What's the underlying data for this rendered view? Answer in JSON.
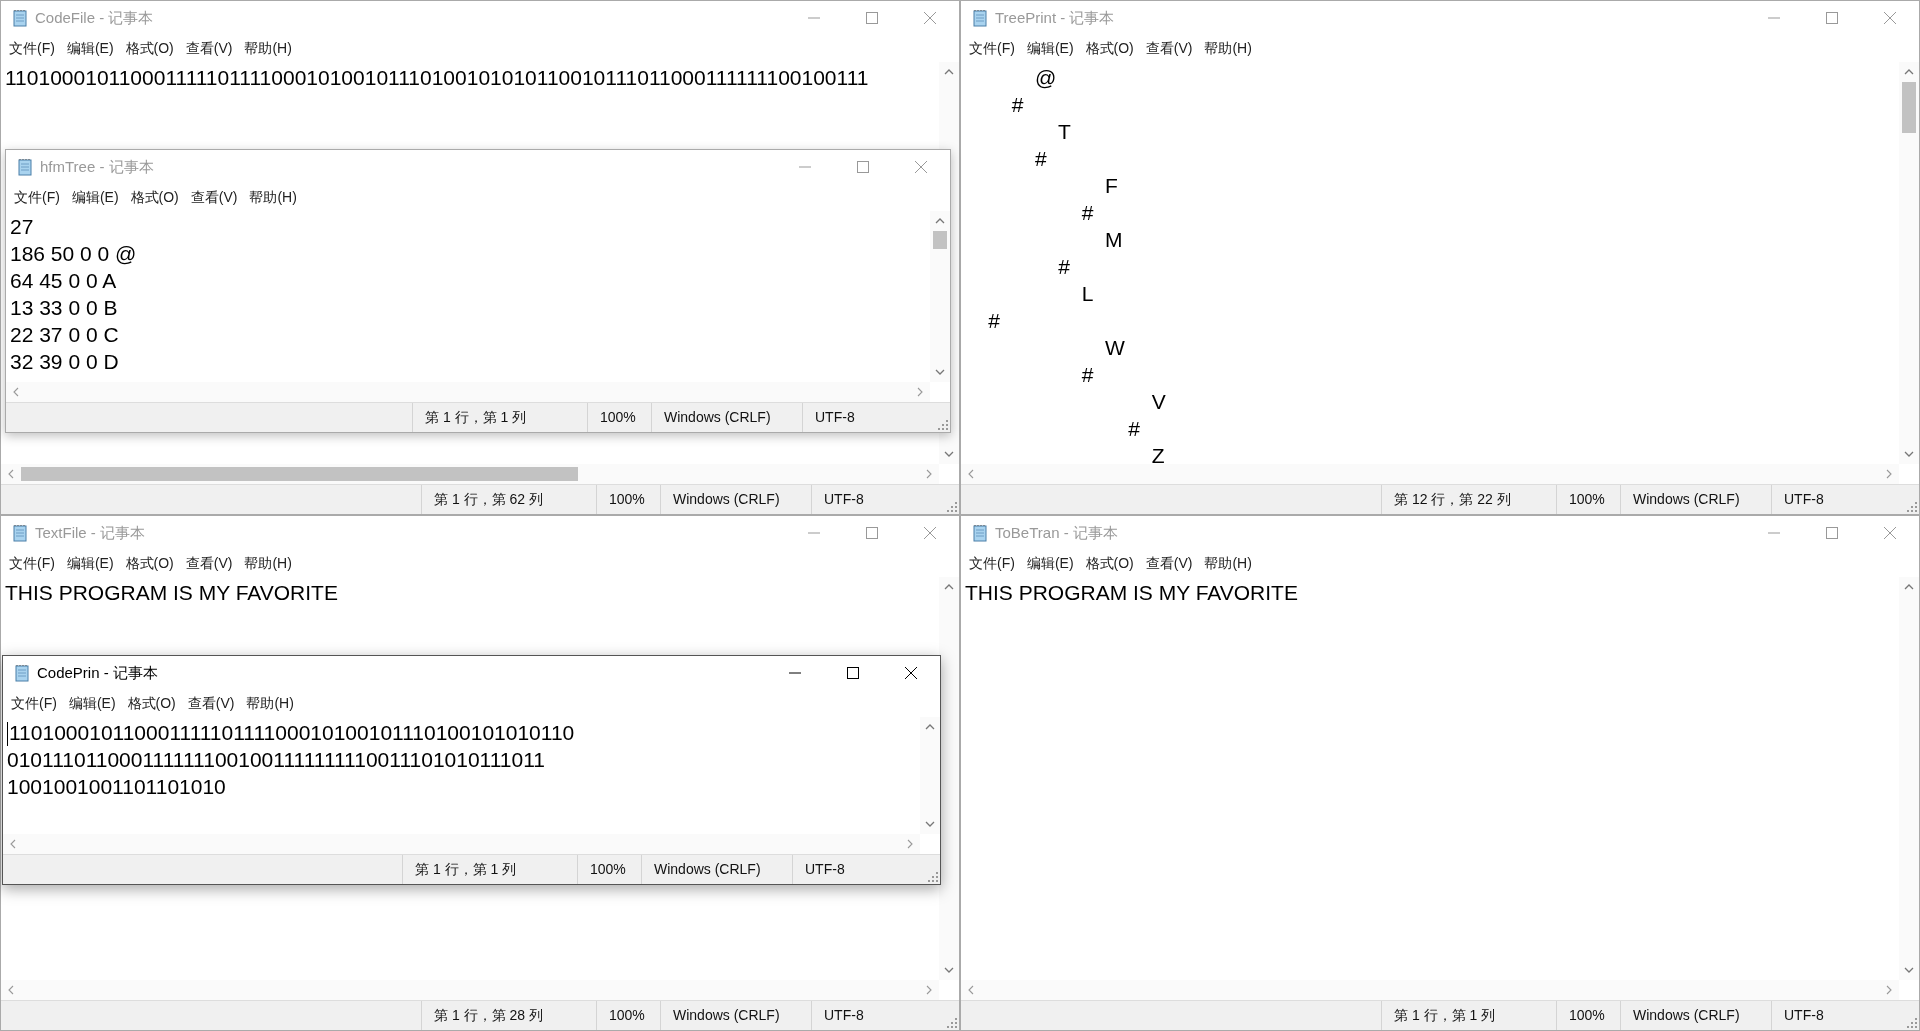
{
  "windows": [
    {
      "title": "CodeFile - 记事本",
      "active": false,
      "caret": false,
      "v_thumb": false,
      "h_thumb": true,
      "menu": [
        "文件(F)",
        "编辑(E)",
        "格式(O)",
        "查看(V)",
        "帮助(H)"
      ],
      "lines": [
        "11010001011000111110111100010100101110100101010110010111011000111111100100111"
      ],
      "status": {
        "position": "第 1 行，第 62 列",
        "zoom": "100%",
        "line_ending": "Windows (CRLF)",
        "encoding": "UTF-8"
      }
    },
    {
      "title": "hfmTree - 记事本",
      "active": false,
      "caret": false,
      "v_thumb": true,
      "h_thumb": false,
      "menu": [
        "文件(F)",
        "编辑(E)",
        "格式(O)",
        "查看(V)",
        "帮助(H)"
      ],
      "lines": [
        "27",
        "186 50 0 0 @",
        "64 45 0 0 A",
        "13 33 0 0 B",
        "22 37 0 0 C",
        "32 39 0 0 D"
      ],
      "status": {
        "position": "第 1 行，第 1 列",
        "zoom": "100%",
        "line_ending": "Windows (CRLF)",
        "encoding": "UTF-8"
      }
    },
    {
      "title": "TreePrint - 记事本",
      "active": false,
      "caret": false,
      "v_thumb": true,
      "h_thumb": false,
      "menu": [
        "文件(F)",
        "编辑(E)",
        "格式(O)",
        "查看(V)",
        "帮助(H)"
      ],
      "lines": [
        "            @",
        "        #",
        "                T",
        "            #",
        "                        F",
        "                    #",
        "                        M",
        "                #",
        "                    L",
        "    #",
        "                        W",
        "                    #",
        "                                V",
        "                            #",
        "                                Z"
      ],
      "status": {
        "position": "第 12 行，第 22 列",
        "zoom": "100%",
        "line_ending": "Windows (CRLF)",
        "encoding": "UTF-8"
      }
    },
    {
      "title": "TextFile - 记事本",
      "active": false,
      "caret": false,
      "v_thumb": false,
      "h_thumb": false,
      "menu": [
        "文件(F)",
        "编辑(E)",
        "格式(O)",
        "查看(V)",
        "帮助(H)"
      ],
      "lines": [
        "THIS PROGRAM IS MY FAVORITE"
      ],
      "status": {
        "position": "第 1 行，第 28 列",
        "zoom": "100%",
        "line_ending": "Windows (CRLF)",
        "encoding": "UTF-8"
      }
    },
    {
      "title": "CodePrin - 记事本",
      "active": true,
      "caret": true,
      "v_thumb": false,
      "h_thumb": false,
      "menu": [
        "文件(F)",
        "编辑(E)",
        "格式(O)",
        "查看(V)",
        "帮助(H)"
      ],
      "lines": [
        "11010001011000111110111100010100101110100101010110",
        "0101110110001111111001001111111110011101010111011",
        "1001001001101101010"
      ],
      "status": {
        "position": "第 1 行，第 1 列",
        "zoom": "100%",
        "line_ending": "Windows (CRLF)",
        "encoding": "UTF-8"
      }
    },
    {
      "title": "ToBeTran - 记事本",
      "active": false,
      "caret": false,
      "v_thumb": false,
      "h_thumb": false,
      "menu": [
        "文件(F)",
        "编辑(E)",
        "格式(O)",
        "查看(V)",
        "帮助(H)"
      ],
      "lines": [
        "THIS PROGRAM IS MY FAVORITE"
      ],
      "status": {
        "position": "第 1 行，第 1 列",
        "zoom": "100%",
        "line_ending": "Windows (CRLF)",
        "encoding": "UTF-8"
      }
    }
  ]
}
